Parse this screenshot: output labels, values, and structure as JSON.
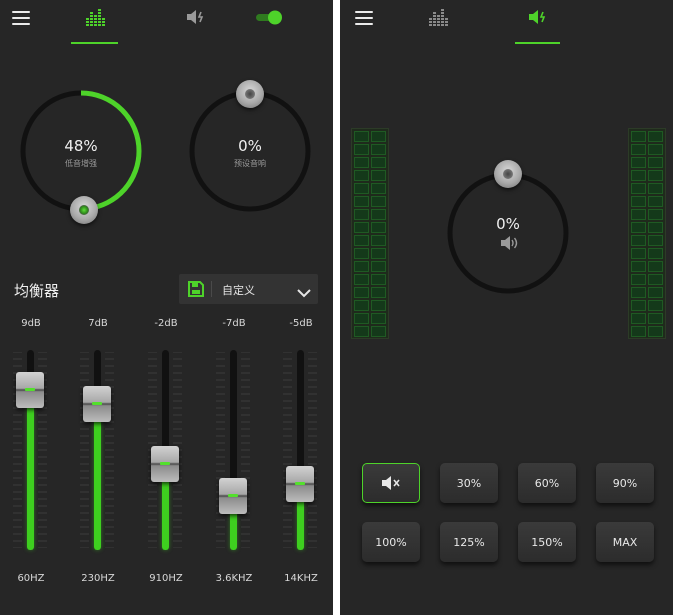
{
  "colors": {
    "accent": "#4ed32a",
    "background": "#262626",
    "track": "#111111"
  },
  "left": {
    "tabs": [
      {
        "icon": "equalizer-icon",
        "active": true
      },
      {
        "icon": "volume-boost-icon",
        "active": false
      },
      {
        "icon": "toggle-switch",
        "active": false,
        "state": "on"
      }
    ],
    "bass_boost": {
      "value": "48%",
      "label": "低音增强",
      "level": 0.48
    },
    "virtualizer": {
      "value": "0%",
      "label": "预设音响",
      "level": 0.0
    },
    "equalizer": {
      "title": "均衡器",
      "preset": "自定义",
      "bands": [
        {
          "db": "9dB",
          "freq": "60HZ",
          "level": 0.8
        },
        {
          "db": "7dB",
          "freq": "230HZ",
          "level": 0.73
        },
        {
          "db": "-2dB",
          "freq": "910HZ",
          "level": 0.43
        },
        {
          "db": "-7dB",
          "freq": "3.6KHZ",
          "level": 0.27
        },
        {
          "db": "-5dB",
          "freq": "14KHZ",
          "level": 0.33
        }
      ]
    }
  },
  "right": {
    "tabs": [
      {
        "icon": "equalizer-icon",
        "active": false
      },
      {
        "icon": "volume-boost-icon",
        "active": true
      }
    ],
    "volume_dial": {
      "value": "0%",
      "level": 0.0,
      "icon": "speaker-icon"
    },
    "presets": [
      {
        "label": "",
        "icon": "mute-icon",
        "active": true
      },
      {
        "label": "30%"
      },
      {
        "label": "60%"
      },
      {
        "label": "90%"
      },
      {
        "label": "100%"
      },
      {
        "label": "125%"
      },
      {
        "label": "150%"
      },
      {
        "label": "MAX"
      }
    ]
  }
}
